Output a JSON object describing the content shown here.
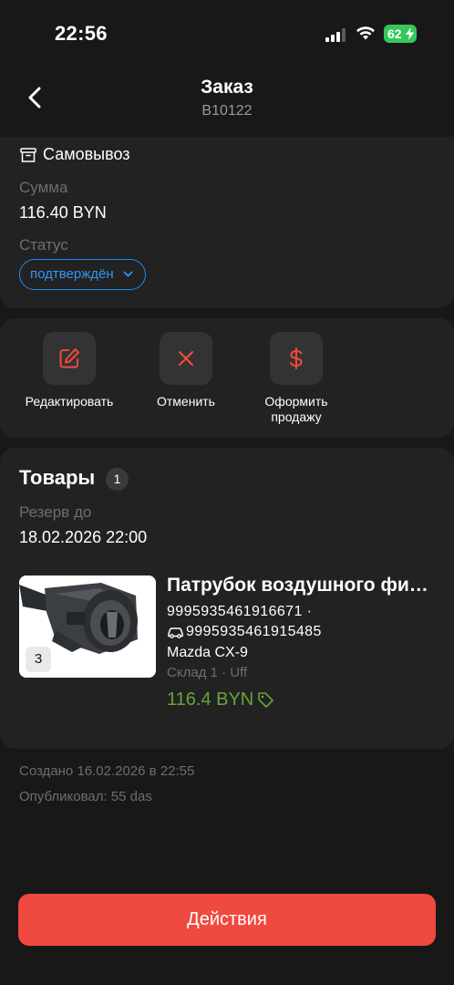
{
  "status_bar": {
    "time": "22:56",
    "battery": "62",
    "icons": [
      "signal-icon",
      "wifi-icon",
      "battery-icon"
    ]
  },
  "header": {
    "title": "Заказ",
    "subtitle": "В10122",
    "back_icon": "chevron-left-icon"
  },
  "order": {
    "delivery_icon": "archive-box-icon",
    "delivery_type": "Самовывоз",
    "sum_label": "Сумма",
    "sum_value": "116.40 BYN",
    "status_label": "Статус",
    "status_value": "подтверждён"
  },
  "actions": [
    {
      "label": "Редактировать",
      "icon": "edit-icon"
    },
    {
      "label": "Отменить",
      "icon": "close-icon"
    },
    {
      "label": "Оформить продажу",
      "icon": "dollar-icon"
    }
  ],
  "goods": {
    "title": "Товары",
    "count": "1",
    "reserve_label": "Резерв до",
    "reserve_value": "18.02.2026 22:00",
    "items": [
      {
        "name": "Патрубок воздушного фильтра",
        "code": "9995935461916671 ·",
        "alt_code": "9995935461915485",
        "car": "Mazda CX-9",
        "stock": "Склад 1 · Uff",
        "price": "116.4 BYN",
        "quantity": "3"
      }
    ]
  },
  "meta": {
    "created": "Создано 16.02.2026 в 22:55",
    "published": "Опубликовал: 55 das"
  },
  "footer": {
    "button_label": "Действия"
  },
  "colors": {
    "background": "#181818",
    "card": "#222222",
    "accent_red": "#f0493f",
    "status_blue": "#1d8cf0",
    "price_green": "#6aa33a"
  }
}
